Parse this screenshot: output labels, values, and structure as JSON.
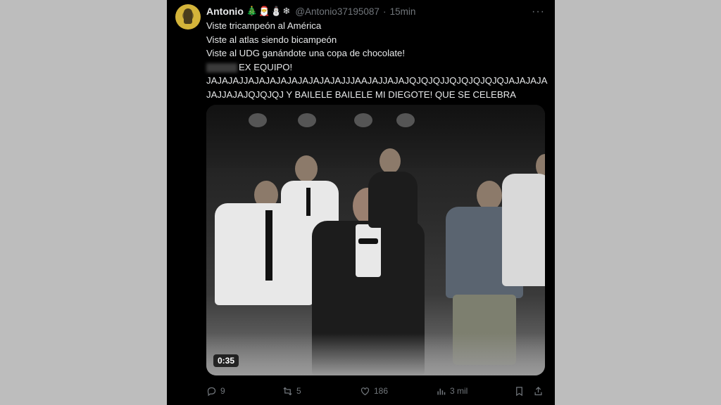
{
  "tweet": {
    "author_name": "Antonio",
    "author_emojis": "🎄🎅⛄❄",
    "handle": "@Antonio37195087",
    "separator": "·",
    "time": "15min",
    "more": "···",
    "lines": [
      "Viste tricampeón al América",
      "Viste al atlas siendo bicampeón",
      "Viste al UDG ganándote una copa de chocolate!",
      "EX EQUIPO!",
      "JAJAJAJJAJAJAJAJAJAJAJAJAJJJAAJAJJAJAJQJQJQJJQJQJQJQJQJAJAJAJA",
      "JAJJAJAJQJQJQJ Y BAILELE BAILELE MI DIEGOTE! QUE SE CELEBRA"
    ],
    "video_duration": "0:35",
    "actions": {
      "replies": "9",
      "reposts": "5",
      "likes": "186",
      "views": "3 mil"
    }
  },
  "icons": [
    "avatar",
    "more-icon",
    "reply-icon",
    "repost-icon",
    "like-icon",
    "views-icon",
    "bookmark-icon",
    "share-icon"
  ]
}
